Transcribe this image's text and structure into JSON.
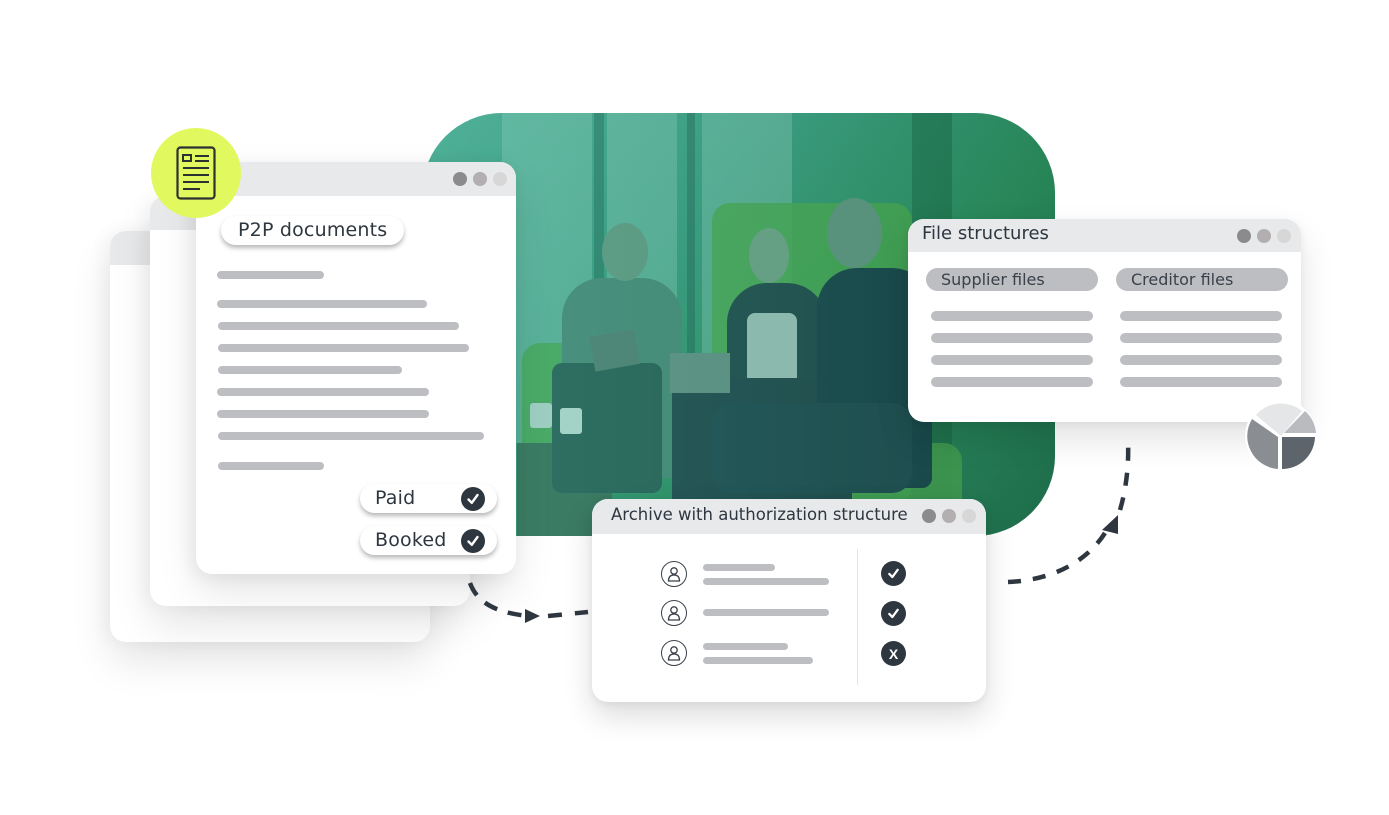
{
  "doc_window": {
    "title_pill": "P2P documents",
    "status_items": [
      {
        "label": "Paid",
        "state": "checked"
      },
      {
        "label": "Booked",
        "state": "checked"
      }
    ],
    "badge_icon": "document-icon"
  },
  "files_window": {
    "title": "File structures",
    "columns": [
      {
        "label": "Supplier files"
      },
      {
        "label": "Creditor files"
      }
    ]
  },
  "archive_window": {
    "title": "Archive with authorization structure",
    "rows": [
      {
        "icon": "user-icon",
        "status": "approved"
      },
      {
        "icon": "user-icon",
        "status": "approved"
      },
      {
        "icon": "user-icon",
        "status": "rejected"
      }
    ],
    "rejected_glyph": "X"
  },
  "colors": {
    "accent_yellow": "#e2f85f",
    "photo_green": "#2c8f5b",
    "dark": "#2e3640",
    "placeholder_gray": "#bcbec1"
  }
}
